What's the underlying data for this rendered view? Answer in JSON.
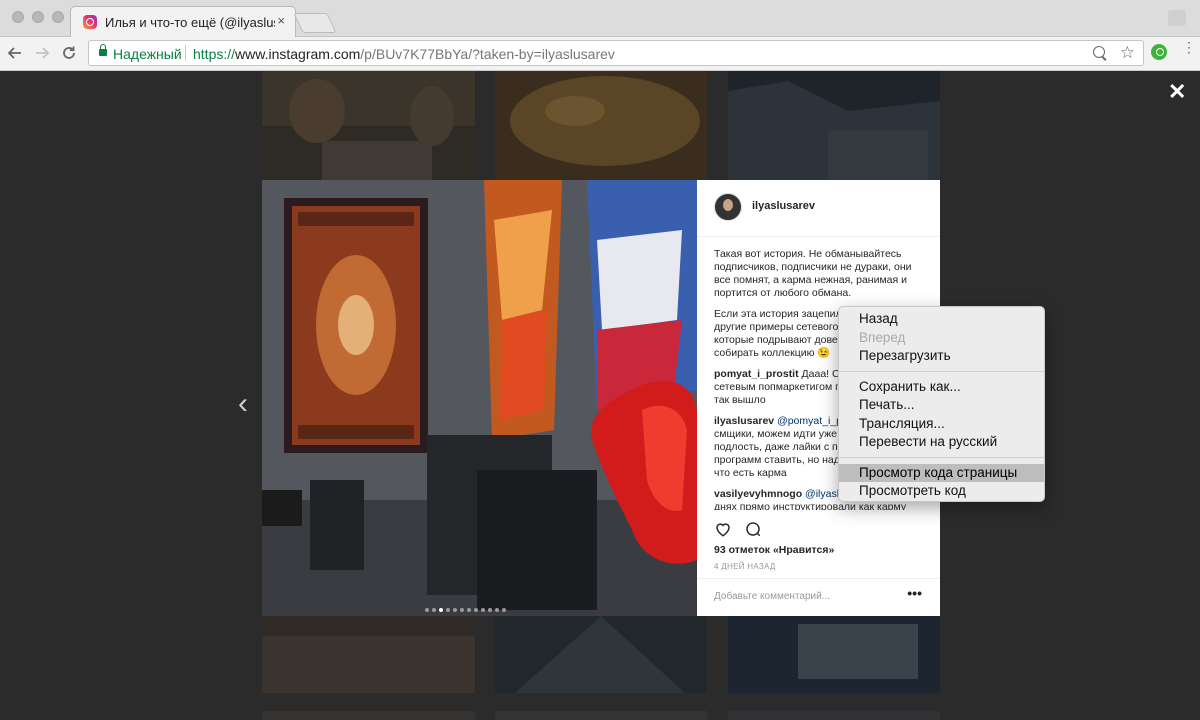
{
  "browser": {
    "tab_title": "Илья и что-то ещё (@ilyaslusarev)",
    "tab_close": "×",
    "nav": {
      "back_icon": "‹",
      "forward_icon": "›",
      "reload_icon": "↻"
    },
    "security_label": "Надежный",
    "url": {
      "scheme": "https://",
      "host": "www.instagram.com",
      "path": "/p/BUv7K77BbYa/?taken-by=ilyaslusarev"
    },
    "icons": [
      "zoom-icon",
      "star-icon",
      "extension-icon",
      "menu-icon"
    ]
  },
  "modal": {
    "close_icon": "✕",
    "prev_icon": "‹",
    "carousel": {
      "count": 12,
      "active_index": 2
    },
    "post": {
      "username": "ilyaslusarev",
      "comments": [
        {
          "user": "",
          "text": "Такая вот история. Не обманывайтесь подписчиков, подписчики не дураки, они все помнят, а карма нежная, ранимая и портится от любого обмана."
        },
        {
          "user": "",
          "text": "Если эта история зацепила, в сети есть и другие примеры сетевого маркетинга, которые подрывают доверие, можно собирать коллекцию 😉"
        },
        {
          "user": "pomyat_i_prostit",
          "mention": "",
          "text": "Дааа! Связал бы с сетевым попмаркетигом прям жаль что так вышло"
        },
        {
          "user": "ilyaslusarev",
          "mention": "@pomyat_i_prostit",
          "text": " как смщики, можем идти уже на любую подлость, даже лайки с помощью программ ставить, но надо помнить 😊 что есть карма"
        },
        {
          "user": "vasilyevyhmnogo",
          "mention": "@ilyaslusarev",
          "text": " же на днях прямо инструктировали как карму делать эту. Скоро будут"
        }
      ],
      "likes": "93 отметок «Нравится»",
      "time_ago": "4 ДНЕЙ НАЗАД",
      "add_comment_placeholder": "Добавьте комментарий...",
      "more_icon": "•••"
    }
  },
  "context_menu": {
    "items": [
      {
        "label": "Назад",
        "disabled": false
      },
      {
        "label": "Вперед",
        "disabled": true
      },
      {
        "label": "Перезагрузить",
        "disabled": false
      },
      {
        "label": "Сохранить как...",
        "disabled": false
      },
      {
        "label": "Печать...",
        "disabled": false
      },
      {
        "label": "Трансляция...",
        "disabled": false
      },
      {
        "label": "Перевести на русский",
        "disabled": false
      },
      {
        "label": "Просмотр кода страницы",
        "disabled": false,
        "highlighted": true
      },
      {
        "label": "Просмотреть код",
        "disabled": false
      }
    ]
  },
  "colors": {
    "secure_green": "#0b8043",
    "menu_highlight": "#bdbdbd",
    "overlay": "#2b2b2b"
  }
}
